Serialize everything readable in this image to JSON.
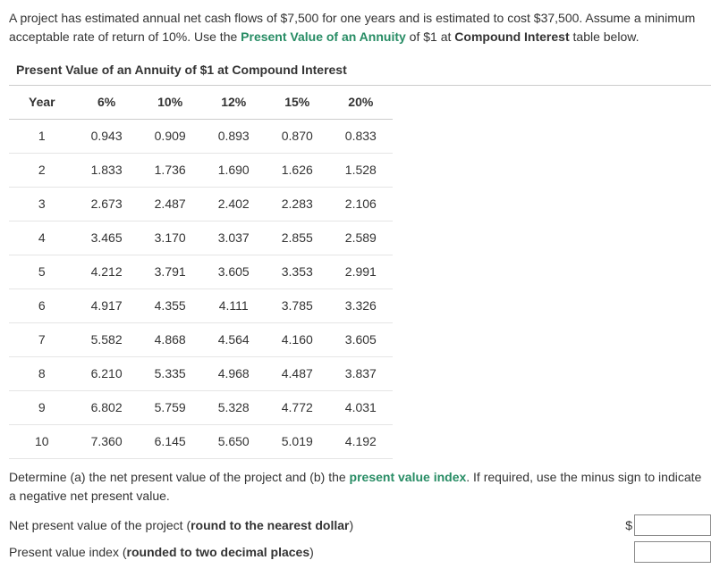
{
  "intro": {
    "part1": "A project has estimated annual net cash flows of $7,500 for one years and is estimated to cost $37,500. Assume a minimum acceptable rate of return of 10%. Use the ",
    "highlight1": "Present Value of an Annuity",
    "part2": " of $1 at ",
    "bold_end": "Compound Interest",
    "part3": " table below."
  },
  "table": {
    "title": "Present Value of an Annuity of $1 at Compound Interest",
    "headers": [
      "Year",
      "6%",
      "10%",
      "12%",
      "15%",
      "20%"
    ],
    "rows": [
      [
        "1",
        "0.943",
        "0.909",
        "0.893",
        "0.870",
        "0.833"
      ],
      [
        "2",
        "1.833",
        "1.736",
        "1.690",
        "1.626",
        "1.528"
      ],
      [
        "3",
        "2.673",
        "2.487",
        "2.402",
        "2.283",
        "2.106"
      ],
      [
        "4",
        "3.465",
        "3.170",
        "3.037",
        "2.855",
        "2.589"
      ],
      [
        "5",
        "4.212",
        "3.791",
        "3.605",
        "3.353",
        "2.991"
      ],
      [
        "6",
        "4.917",
        "4.355",
        "4.111",
        "3.785",
        "3.326"
      ],
      [
        "7",
        "5.582",
        "4.868",
        "4.564",
        "4.160",
        "3.605"
      ],
      [
        "8",
        "6.210",
        "5.335",
        "4.968",
        "4.487",
        "3.837"
      ],
      [
        "9",
        "6.802",
        "5.759",
        "5.328",
        "4.772",
        "4.031"
      ],
      [
        "10",
        "7.360",
        "6.145",
        "5.650",
        "5.019",
        "4.192"
      ]
    ]
  },
  "question": {
    "part1": "Determine (a) the net present value of the project and (b) the ",
    "highlight": "present value index",
    "part2": ". If required, use the minus sign to indicate a negative net present value."
  },
  "prompts": {
    "npv_label_prefix": "Net present value of the project (",
    "npv_label_bold": "round to the nearest dollar",
    "npv_label_suffix": ")",
    "dollar_sign": "$",
    "pvi_label_prefix": "Present value index (",
    "pvi_label_bold": "rounded to two decimal places",
    "pvi_label_suffix": ")"
  }
}
